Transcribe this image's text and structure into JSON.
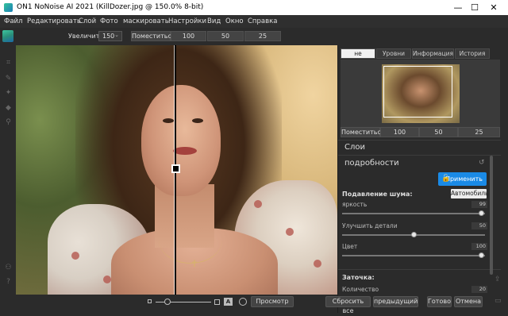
{
  "window": {
    "title": "ON1 NoNoise AI 2021 (KillDozer.jpg @ 150.0% 8-bit)",
    "minimize": "—",
    "maximize": "☐",
    "close": "✕"
  },
  "menu": [
    "Файл",
    "Редактировать",
    "Слой",
    "Фото",
    "маскировать",
    "Настройки",
    "Вид",
    "Окно",
    "Справка"
  ],
  "toolbar": {
    "zoom_label": "Увеличить",
    "zoom_value": "150",
    "fit": "Поместиться",
    "z100": "100",
    "z50": "50",
    "z25": "25"
  },
  "tools": [
    "crop-icon",
    "brush-icon",
    "retouch-icon",
    "eraser-icon",
    "zoom-icon",
    "hand-icon",
    "help-icon"
  ],
  "right": {
    "tabs": [
      "не",
      "Уровни",
      "Информация",
      "История"
    ],
    "zoom": {
      "fit": "Поместиться",
      "z100": "100",
      "z50": "50",
      "z25": "25"
    },
    "layers_title": "Слои",
    "details_title": "подробности",
    "apply_label": "Применить",
    "noise_reduction_label": "Подавление шума:",
    "auto_label": "Автомобиль",
    "sliders": [
      {
        "label": "яркость",
        "value": "99",
        "fraction": 0.99
      },
      {
        "label": "Улучшить детали",
        "value": "50",
        "fraction": 0.5
      },
      {
        "label": "Цвет",
        "value": "100",
        "fraction": 1.0
      }
    ],
    "sharpen_label": "Заточка:",
    "amount_label": "Количество",
    "amount_value": "20"
  },
  "bottom": {
    "preview": "Просмотр",
    "reset_all": "Сбросить все",
    "previous": "предыдущий",
    "done": "Готово",
    "cancel": "Отмена",
    "compare_a": "A"
  },
  "colors": {
    "accent": "#1a8ae6",
    "background": "#2b2b2b"
  }
}
